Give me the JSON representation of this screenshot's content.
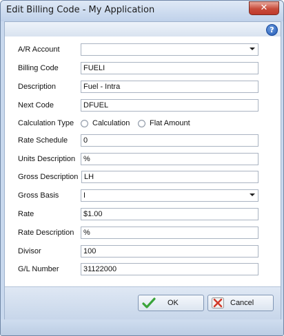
{
  "window": {
    "title": "Edit Billing Code - My Application",
    "close_glyph": "✕"
  },
  "help": {
    "glyph": "?"
  },
  "form": {
    "ar_account": {
      "label": "A/R Account",
      "value": ""
    },
    "billing_code": {
      "label": "Billing Code",
      "value": "FUELI"
    },
    "description": {
      "label": "Description",
      "value": "Fuel - Intra"
    },
    "next_code": {
      "label": "Next Code",
      "value": "DFUEL"
    },
    "calculation_type": {
      "label": "Calculation Type",
      "options": [
        "Calculation",
        "Flat Amount"
      ],
      "selected": ""
    },
    "rate_schedule": {
      "label": "Rate Schedule",
      "value": "0"
    },
    "units_description": {
      "label": "Units Description",
      "value": "%"
    },
    "gross_description": {
      "label": "Gross Description",
      "value": "LH"
    },
    "gross_basis": {
      "label": "Gross Basis",
      "value": "I"
    },
    "rate": {
      "label": "Rate",
      "value": "$1.00"
    },
    "rate_description": {
      "label": "Rate Description",
      "value": "%"
    },
    "divisor": {
      "label": "Divisor",
      "value": "100"
    },
    "gl_number": {
      "label": "G/L Number",
      "value": "31122000"
    }
  },
  "buttons": {
    "ok": "OK",
    "cancel": "Cancel"
  },
  "colors": {
    "ok_icon": "#3aa43a",
    "cancel_icon": "#d23a2a",
    "window_frame": "#c9d9ee"
  }
}
